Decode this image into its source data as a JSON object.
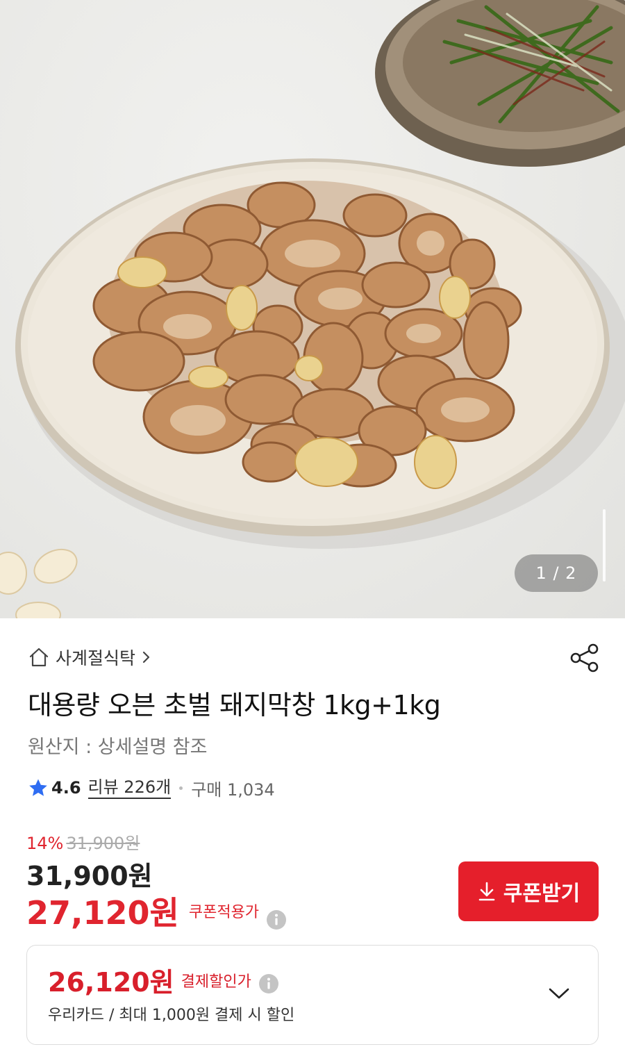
{
  "gallery": {
    "image": "grilled-pork-intestine-plate-photo",
    "page_indicator": "1 / 2"
  },
  "store": {
    "name": "사계절식탁",
    "icon": "home-icon"
  },
  "product": {
    "title": "대용량 오븐 초벌 돼지막창 1kg+1kg",
    "origin": "원산지 : 상세설명 참조"
  },
  "rating": {
    "score": "4.6",
    "reviews": "리뷰 226개",
    "purchases": "구매 1,034"
  },
  "price": {
    "discount_rate": "14%",
    "original": "31,900원",
    "current": "31,900원",
    "coupon_price": "27,120원",
    "coupon_label": "쿠폰적용가",
    "coupon_button": "쿠폰받기"
  },
  "payment": {
    "price": "26,120원",
    "label": "결제할인가",
    "detail": "우리카드 / 최대 1,000원 결제 시 할인"
  },
  "colors": {
    "accent": "#e51f2b",
    "star": "#2f6df2"
  }
}
